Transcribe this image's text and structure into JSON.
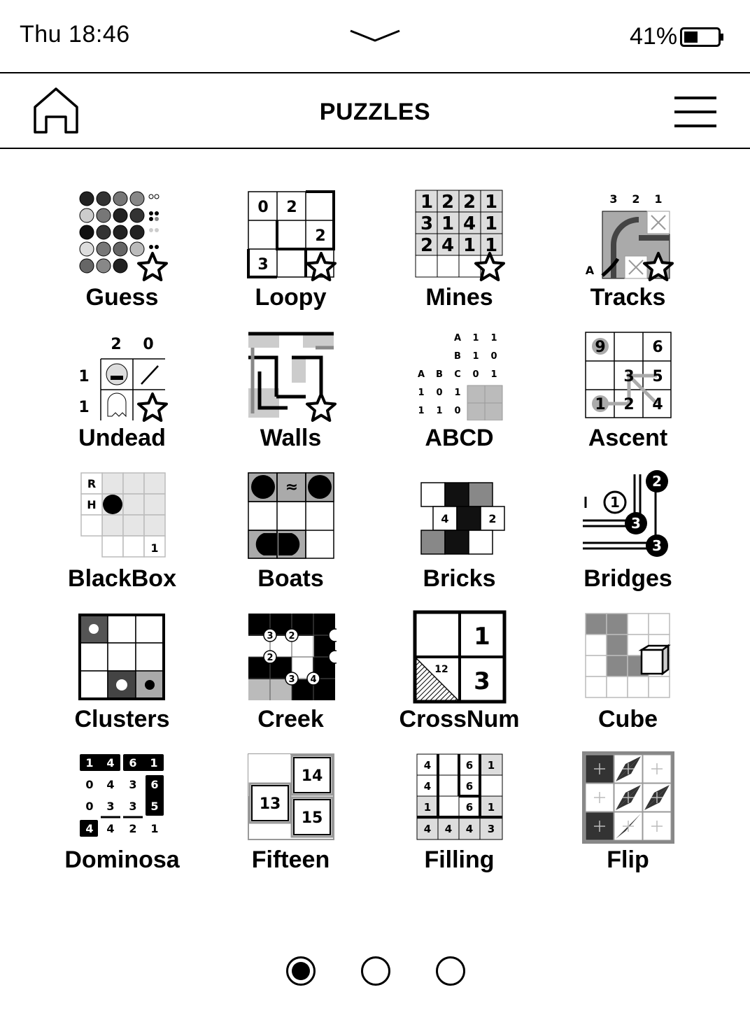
{
  "status_bar": {
    "time": "Thu 18:46",
    "battery": "41%",
    "battery_level": 0.41
  },
  "header": {
    "title": "PUZZLES",
    "home_icon": "home-icon",
    "menu_icon": "hamburger-menu-icon"
  },
  "puzzles": [
    {
      "label": "Guess"
    },
    {
      "label": "Loopy"
    },
    {
      "label": "Mines"
    },
    {
      "label": "Tracks"
    },
    {
      "label": "Undead"
    },
    {
      "label": "Walls"
    },
    {
      "label": "ABCD"
    },
    {
      "label": "Ascent"
    },
    {
      "label": "BlackBox"
    },
    {
      "label": "Boats"
    },
    {
      "label": "Bricks"
    },
    {
      "label": "Bridges"
    },
    {
      "label": "Clusters"
    },
    {
      "label": "Creek"
    },
    {
      "label": "CrossNum"
    },
    {
      "label": "Cube"
    },
    {
      "label": "Dominosa"
    },
    {
      "label": "Fifteen"
    },
    {
      "label": "Filling"
    },
    {
      "label": "Flip"
    }
  ],
  "favorites": [
    "Guess",
    "Loopy",
    "Mines",
    "Tracks",
    "Undead",
    "Walls"
  ],
  "pagination": {
    "pages": 3,
    "current": 1
  }
}
